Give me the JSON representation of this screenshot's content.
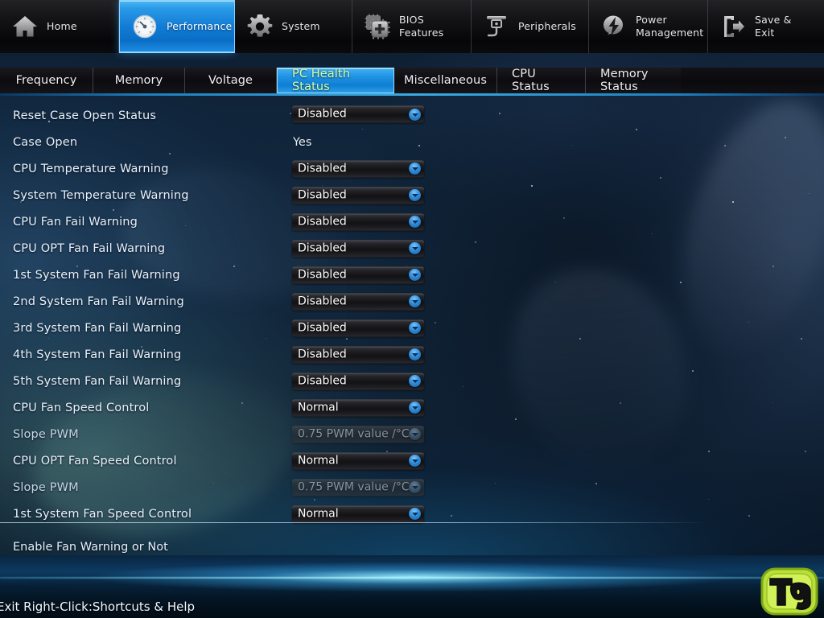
{
  "topnav": {
    "items": [
      {
        "label": "Home",
        "icon": "home-icon",
        "active": false
      },
      {
        "label": "Performance",
        "icon": "gauge-icon",
        "active": true
      },
      {
        "label": "System",
        "icon": "gear-icon",
        "active": false
      },
      {
        "label": "BIOS\nFeatures",
        "icon": "chip-plus-icon",
        "active": false
      },
      {
        "label": "Peripherals",
        "icon": "peripherals-icon",
        "active": false
      },
      {
        "label": "Power\nManagement",
        "icon": "power-bolt-icon",
        "active": false
      },
      {
        "label": "Save & Exit",
        "icon": "exit-door-icon",
        "active": false
      }
    ]
  },
  "subtabs": {
    "items": [
      {
        "label": "Frequency",
        "active": false
      },
      {
        "label": "Memory",
        "active": false
      },
      {
        "label": "Voltage",
        "active": false
      },
      {
        "label": "PC Health Status",
        "active": true
      },
      {
        "label": "Miscellaneous",
        "active": false
      },
      {
        "label": "CPU Status",
        "active": false
      },
      {
        "label": "Memory Status",
        "active": false
      }
    ]
  },
  "settings": {
    "rows": [
      {
        "name": "Reset Case Open Status",
        "value": "Disabled",
        "control": "dropdown",
        "disabled": false
      },
      {
        "name": "Case Open",
        "value": "Yes",
        "control": "text",
        "disabled": false
      },
      {
        "name": "CPU Temperature Warning",
        "value": "Disabled",
        "control": "dropdown",
        "disabled": false
      },
      {
        "name": "System Temperature Warning",
        "value": "Disabled",
        "control": "dropdown",
        "disabled": false
      },
      {
        "name": "CPU Fan Fail Warning",
        "value": "Disabled",
        "control": "dropdown",
        "disabled": false
      },
      {
        "name": "CPU OPT Fan Fail Warning",
        "value": "Disabled",
        "control": "dropdown",
        "disabled": false
      },
      {
        "name": "1st System Fan Fail Warning",
        "value": "Disabled",
        "control": "dropdown",
        "disabled": false
      },
      {
        "name": "2nd System Fan Fail Warning",
        "value": "Disabled",
        "control": "dropdown",
        "disabled": false
      },
      {
        "name": "3rd System Fan Fail Warning",
        "value": "Disabled",
        "control": "dropdown",
        "disabled": false
      },
      {
        "name": "4th System Fan Fail Warning",
        "value": "Disabled",
        "control": "dropdown",
        "disabled": false
      },
      {
        "name": "5th System Fan Fail Warning",
        "value": "Disabled",
        "control": "dropdown",
        "disabled": false
      },
      {
        "name": "CPU Fan Speed Control",
        "value": "Normal",
        "control": "dropdown",
        "disabled": false
      },
      {
        "name": "Slope PWM",
        "value": "0.75 PWM value /°C",
        "control": "dropdown",
        "disabled": true
      },
      {
        "name": "CPU OPT Fan Speed Control",
        "value": "Normal",
        "control": "dropdown",
        "disabled": false
      },
      {
        "name": "Slope PWM",
        "value": "0.75 PWM value /°C",
        "control": "dropdown",
        "disabled": true
      },
      {
        "name": "1st System Fan Speed Control",
        "value": "Normal",
        "control": "dropdown",
        "disabled": false
      }
    ]
  },
  "help": {
    "text": "Enable Fan Warning or Not"
  },
  "statusbar": {
    "text": "Exit Right-Click:Shortcuts & Help"
  },
  "branding": {
    "logo_text": "Tg"
  },
  "colors": {
    "accent_blue": "#1f93e4",
    "active_tab_text": "#d8ffa0",
    "logo_green": "#c8e84a",
    "text_primary": "#e9f2fb"
  }
}
